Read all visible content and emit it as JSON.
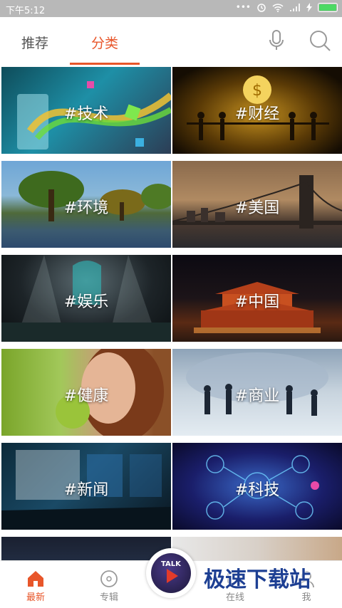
{
  "status_bar": {
    "time": "下午5:12",
    "dots": "•••",
    "battery_color": "#4cd964"
  },
  "tabs": {
    "recommend": "推荐",
    "category": "分类",
    "active_color": "#e8562a"
  },
  "categories": [
    {
      "label": "#技术"
    },
    {
      "label": "#财经"
    },
    {
      "label": "#环境"
    },
    {
      "label": "#美国"
    },
    {
      "label": "#娱乐"
    },
    {
      "label": "#中国"
    },
    {
      "label": "#健康"
    },
    {
      "label": "#商业"
    },
    {
      "label": "#新闻"
    },
    {
      "label": "#科技"
    }
  ],
  "bottom_nav": [
    {
      "label": "最新",
      "icon": "home-icon",
      "active": true
    },
    {
      "label": "专辑",
      "icon": "album-icon",
      "active": false
    },
    {
      "label": "在线",
      "icon": "online-icon",
      "active": false
    },
    {
      "label": "我",
      "icon": "user-icon",
      "active": false
    }
  ],
  "center_logo": {
    "text": "TALK"
  },
  "watermark": "极速下载站"
}
